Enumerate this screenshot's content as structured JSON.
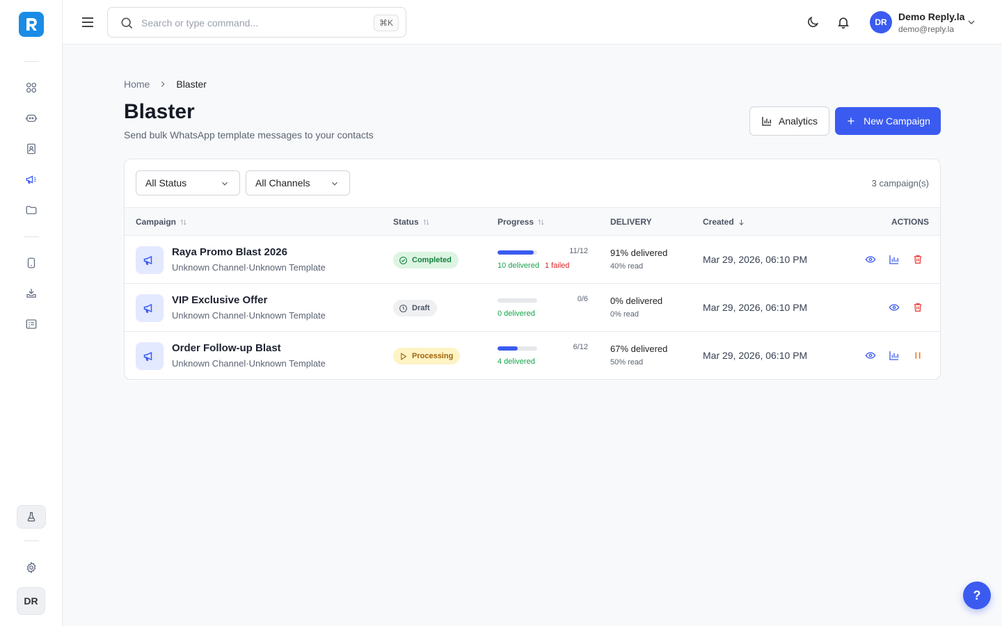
{
  "search": {
    "placeholder": "Search or type command...",
    "shortcut": "⌘K"
  },
  "user": {
    "initials": "DR",
    "name": "Demo Reply.la",
    "email": "demo@reply.la"
  },
  "sidebar": {
    "avatar_initials": "DR"
  },
  "breadcrumb": {
    "home": "Home",
    "current": "Blaster"
  },
  "page": {
    "title": "Blaster",
    "subtitle": "Send bulk WhatsApp template messages to your contacts"
  },
  "buttons": {
    "analytics": "Analytics",
    "new_campaign": "New Campaign"
  },
  "filters": {
    "status": "All Status",
    "channels": "All Channels",
    "count": "3 campaign(s)"
  },
  "table": {
    "headers": {
      "campaign": "Campaign",
      "status": "Status",
      "progress": "Progress",
      "delivery": "DELIVERY",
      "created": "Created",
      "actions": "ACTIONS"
    },
    "rows": [
      {
        "name": "Raya Promo Blast 2026",
        "channel": "Unknown Channel",
        "separator": "·",
        "template": "Unknown Template",
        "status": "Completed",
        "progress_fraction": 0.9167,
        "progress_count": "11/12",
        "delivered": "10 delivered",
        "failed": "1 failed",
        "delivery_pct": "91% delivered",
        "read_pct": "40% read",
        "created": "Mar 29, 2026, 06:10 PM"
      },
      {
        "name": "VIP Exclusive Offer",
        "channel": "Unknown Channel",
        "separator": "·",
        "template": "Unknown Template",
        "status": "Draft",
        "progress_fraction": 0,
        "progress_count": "0/6",
        "delivered": "0 delivered",
        "failed": "",
        "delivery_pct": "0% delivered",
        "read_pct": "0% read",
        "created": "Mar 29, 2026, 06:10 PM"
      },
      {
        "name": "Order Follow-up Blast",
        "channel": "Unknown Channel",
        "separator": "·",
        "template": "Unknown Template",
        "status": "Processing",
        "progress_fraction": 0.5,
        "progress_count": "6/12",
        "delivered": "4 delivered",
        "failed": "",
        "delivery_pct": "67% delivered",
        "read_pct": "50% read",
        "created": "Mar 29, 2026, 06:10 PM"
      }
    ]
  },
  "help": {
    "label": "?"
  },
  "colors": {
    "primary": "#3b5bf0",
    "success": "#16a34a",
    "danger": "#ef4444",
    "warning": "#f97316"
  }
}
